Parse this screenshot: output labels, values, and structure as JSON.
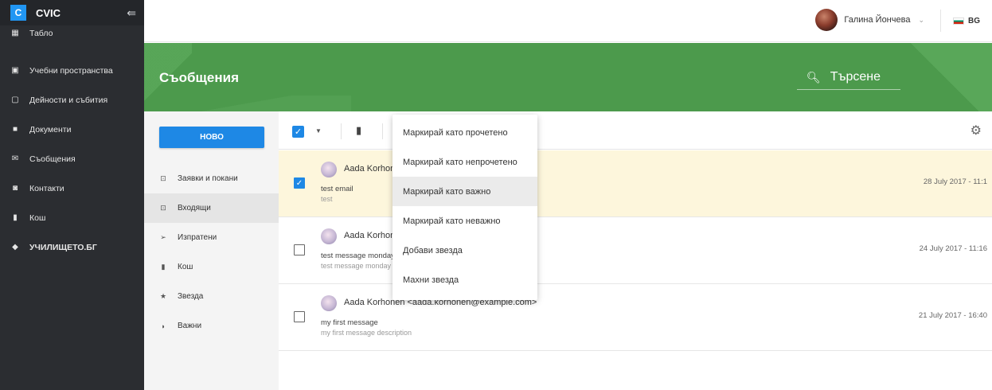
{
  "app": {
    "logo_letter": "C",
    "name": "CVIC",
    "collapse_icon": "collapse-menu-icon"
  },
  "sidebar": {
    "items": [
      {
        "label": "Табло",
        "icon": "grid-icon"
      },
      {
        "label": "Учебни пространства",
        "icon": "building-icon"
      },
      {
        "label": "Дейности и събития",
        "icon": "calendar-icon"
      },
      {
        "label": "Документи",
        "icon": "folder-icon"
      },
      {
        "label": "Съобщения",
        "icon": "envelope-icon"
      },
      {
        "label": "Контакти",
        "icon": "contact-icon"
      },
      {
        "label": "Кош",
        "icon": "trash-icon"
      },
      {
        "label": "УЧИЛИЩЕТО.БГ",
        "icon": "graduation-icon"
      }
    ]
  },
  "header": {
    "user_name": "Галина Йончева",
    "language": "BG"
  },
  "banner": {
    "title": "Съобщения",
    "search_placeholder": "Търсене"
  },
  "mail": {
    "new_button": "НОВО",
    "folders": [
      {
        "label": "Заявки и покани",
        "icon": "inbox-tray-icon"
      },
      {
        "label": "Входящи",
        "icon": "inbox-tray-icon",
        "active": true
      },
      {
        "label": "Изпратени",
        "icon": "send-icon"
      },
      {
        "label": "Кош",
        "icon": "trash-icon"
      },
      {
        "label": "Звезда",
        "icon": "star-icon"
      },
      {
        "label": "Важни",
        "icon": "label-icon"
      }
    ],
    "messages": [
      {
        "sender": "Aada Korhonen <aada.korhonen@example.com>",
        "subject": "test email",
        "description": "test",
        "date": "28 July 2017 - 11:1",
        "checked": true
      },
      {
        "sender": "Aada Korhonen <aada.korhonen@example.com>",
        "subject": "test message monday",
        "description": "test message monday",
        "date": "24 July 2017 - 11:16",
        "checked": false
      },
      {
        "sender": "Aada Korhonen <aada.korhonen@example.com>",
        "subject": "my first message",
        "description": "my first message description",
        "date": "21 July 2017 - 16:40",
        "checked": false
      }
    ]
  },
  "menu": {
    "items": [
      "Маркирай като прочетено",
      "Маркирай като непрочетено",
      "Маркирай като важно",
      "Маркирай като неважно",
      "Добави звезда",
      "Махни звезда"
    ],
    "highlighted_index": 2
  },
  "colors": {
    "sidebar": "#2b2d31",
    "banner": "#4c9a4c",
    "accent": "#1e88e5",
    "selected_row": "#fdf6dc"
  }
}
